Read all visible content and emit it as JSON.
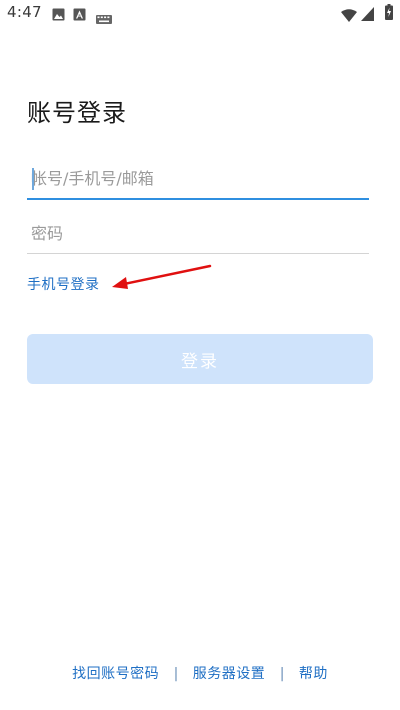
{
  "status_bar": {
    "time": "4:47",
    "icons": [
      "image-icon",
      "text-a-icon",
      "keyboard-icon",
      "wifi-icon",
      "signal-icon",
      "battery-charging-icon"
    ]
  },
  "login": {
    "title": "账号登录",
    "account_placeholder": "帐号/手机号/邮箱",
    "password_placeholder": "密码",
    "phone_login_label": "手机号登录",
    "login_button_label": "登录"
  },
  "footer": {
    "retrieve_password": "找回账号密码",
    "server_settings": "服务器设置",
    "help": "帮助",
    "separator": "|"
  },
  "colors": {
    "accent": "#2f8fe0",
    "link": "#1f6fc4",
    "button_disabled_bg": "#cfe3fb",
    "annotation_arrow": "#e01010"
  }
}
